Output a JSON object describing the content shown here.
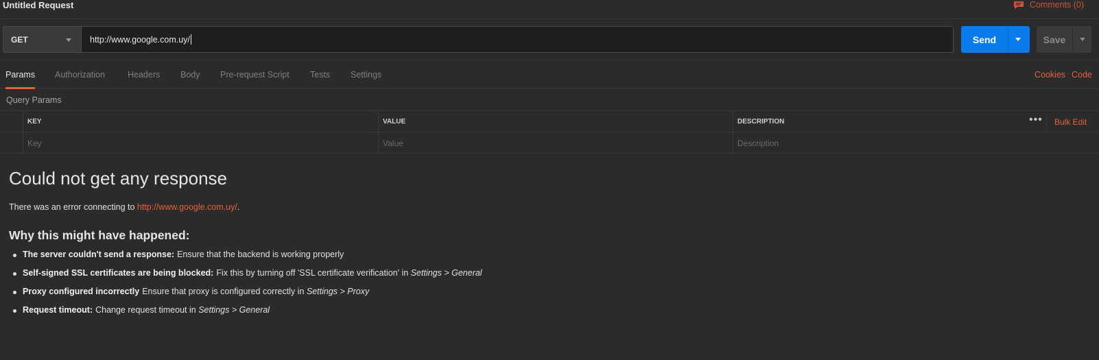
{
  "request": {
    "title": "Untitled Request",
    "comments_label": "Comments (0)",
    "method": "GET",
    "url": "http://www.google.com.uy/",
    "send_label": "Send",
    "save_label": "Save"
  },
  "tabs": [
    {
      "label": "Params",
      "active": true
    },
    {
      "label": "Authorization"
    },
    {
      "label": "Headers"
    },
    {
      "label": "Body"
    },
    {
      "label": "Pre-request Script"
    },
    {
      "label": "Tests"
    },
    {
      "label": "Settings"
    }
  ],
  "tab_links": {
    "cookies": "Cookies",
    "code": "Code"
  },
  "query_params": {
    "title": "Query Params",
    "headers": {
      "key": "KEY",
      "value": "VALUE",
      "description": "DESCRIPTION"
    },
    "placeholders": {
      "key": "Key",
      "value": "Value",
      "description": "Description"
    },
    "bulk_edit": "Bulk Edit"
  },
  "error": {
    "title": "Could not get any response",
    "line_prefix": "There was an error connecting to ",
    "line_url": "http://www.google.com.uy/",
    "line_suffix": ".",
    "why_title": "Why this might have happened:",
    "reasons": [
      {
        "bold": "The server couldn't send a response:",
        "text": "Ensure that the backend is working properly",
        "italic": ""
      },
      {
        "bold": "Self-signed SSL certificates are being blocked:",
        "text": "Fix this by turning off 'SSL certificate verification' in ",
        "italic": "Settings > General"
      },
      {
        "bold": "Proxy configured incorrectly",
        "text": "Ensure that proxy is configured correctly in ",
        "italic": "Settings > Proxy"
      },
      {
        "bold": "Request timeout:",
        "text": "Change request timeout in ",
        "italic": "Settings > General"
      }
    ]
  },
  "colors": {
    "accent": "#e5603e",
    "send": "#097bed",
    "background": "#2b2b2b"
  }
}
